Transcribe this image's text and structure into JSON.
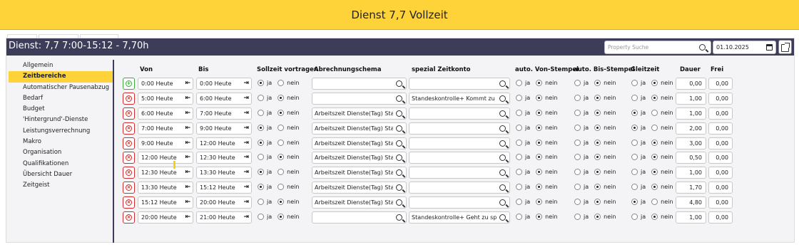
{
  "window": {
    "title": "Dienst 7,7 Vollzeit"
  },
  "toolbar": {
    "title": "Dienst: 7,7 7:00-15:12 - 7,70h",
    "search_placeholder": "Property Suche",
    "date": "01.10.2025",
    "icons": [
      "search-icon",
      "calendar-icon",
      "popout-icon"
    ]
  },
  "sidebar": {
    "items": [
      {
        "label": "Allgemein",
        "active": false
      },
      {
        "label": "Zeitbereiche",
        "active": true
      },
      {
        "label": "Automatischer Pausenabzug",
        "active": false
      },
      {
        "label": "Bedarf",
        "active": false
      },
      {
        "label": "Budget",
        "active": false
      },
      {
        "label": "'Hintergrund'-Dienste",
        "active": false
      },
      {
        "label": "Leistungsverrechnung",
        "active": false
      },
      {
        "label": "Makro",
        "active": false
      },
      {
        "label": "Organisation",
        "active": false
      },
      {
        "label": "Qualifikationen",
        "active": false
      },
      {
        "label": "Übersicht Dauer",
        "active": false
      },
      {
        "label": "Zeitgeist",
        "active": false
      }
    ]
  },
  "table": {
    "headers": {
      "von": "Von",
      "bis": "Bis",
      "sollzeit": "Sollzeit vortragen",
      "abrechnung": "Abrechnungschema",
      "spezial": "spezial Zeitkonto",
      "auto_von": "auto. Von-Stempel",
      "auto_bis": "auto. Bis-Stempel",
      "gleitzeit": "Gleitzeit",
      "dauer": "Dauer",
      "frei": "Frei"
    },
    "radio_labels": {
      "yes": "ja",
      "no": "nein"
    },
    "rows": [
      {
        "action": "add",
        "von": "0:00 Heute",
        "bis": "0:00 Heute",
        "sollzeit": "ja",
        "abrechnung": "",
        "spezial": "",
        "auto_von": "nein",
        "auto_bis": "nein",
        "gleitzeit": "nein",
        "dauer": "0,00",
        "frei": "0,00"
      },
      {
        "action": "remove",
        "von": "5:00 Heute",
        "bis": "6:00 Heute",
        "sollzeit": "nein",
        "abrechnung": "",
        "spezial": "Standeskontrolle+ Kommt zu …",
        "auto_von": "nein",
        "auto_bis": "nein",
        "gleitzeit": "nein",
        "dauer": "1,00",
        "frei": "0,00"
      },
      {
        "action": "remove",
        "von": "6:00 Heute",
        "bis": "7:00 Heute",
        "sollzeit": "nein",
        "abrechnung": "Arbeitszeit Dienste(Tag) Sta…",
        "spezial": "",
        "auto_von": "nein",
        "auto_bis": "nein",
        "gleitzeit": "ja",
        "dauer": "1,00",
        "frei": "0,00"
      },
      {
        "action": "remove",
        "von": "7:00 Heute",
        "bis": "9:00 Heute",
        "sollzeit": "ja",
        "abrechnung": "Arbeitszeit Dienste(Tag) Sta…",
        "spezial": "",
        "auto_von": "nein",
        "auto_bis": "nein",
        "gleitzeit": "ja",
        "dauer": "2,00",
        "frei": "0,00"
      },
      {
        "action": "remove",
        "von": "9:00 Heute",
        "bis": "12:00 Heute",
        "sollzeit": "ja",
        "abrechnung": "Arbeitszeit Dienste(Tag) Sta…",
        "spezial": "",
        "auto_von": "nein",
        "auto_bis": "nein",
        "gleitzeit": "nein",
        "dauer": "3,00",
        "frei": "0,00"
      },
      {
        "action": "remove",
        "von": "12:00 Heute",
        "bis": "12:30 Heute",
        "sollzeit": "nein",
        "abrechnung": "Arbeitszeit Dienste(Tag) Sta…",
        "spezial": "",
        "auto_von": "nein",
        "auto_bis": "nein",
        "gleitzeit": "nein",
        "dauer": "0,50",
        "frei": "0,00"
      },
      {
        "action": "remove",
        "von": "12:30 Heute",
        "bis": "13:30 Heute",
        "sollzeit": "ja",
        "abrechnung": "Arbeitszeit Dienste(Tag) Sta…",
        "spezial": "",
        "auto_von": "nein",
        "auto_bis": "nein",
        "gleitzeit": "nein",
        "dauer": "1,00",
        "frei": "0,00"
      },
      {
        "action": "remove",
        "von": "13:30 Heute",
        "bis": "15:12 Heute",
        "sollzeit": "ja",
        "abrechnung": "Arbeitszeit Dienste(Tag) Sta…",
        "spezial": "",
        "auto_von": "nein",
        "auto_bis": "nein",
        "gleitzeit": "nein",
        "dauer": "1,70",
        "frei": "0,00"
      },
      {
        "action": "remove",
        "von": "15:12 Heute",
        "bis": "20:00 Heute",
        "sollzeit": "nein",
        "abrechnung": "Arbeitszeit Dienste(Tag) Sta…",
        "spezial": "",
        "auto_von": "nein",
        "auto_bis": "nein",
        "gleitzeit": "ja",
        "dauer": "4,80",
        "frei": "0,00"
      },
      {
        "action": "remove",
        "von": "20:00 Heute",
        "bis": "21:00 Heute",
        "sollzeit": "nein",
        "abrechnung": "",
        "spezial": "Standeskontrolle+ Geht zu spät",
        "auto_von": "nein",
        "auto_bis": "nein",
        "gleitzeit": "nein",
        "dauer": "1,00",
        "frei": "0,00"
      }
    ]
  }
}
